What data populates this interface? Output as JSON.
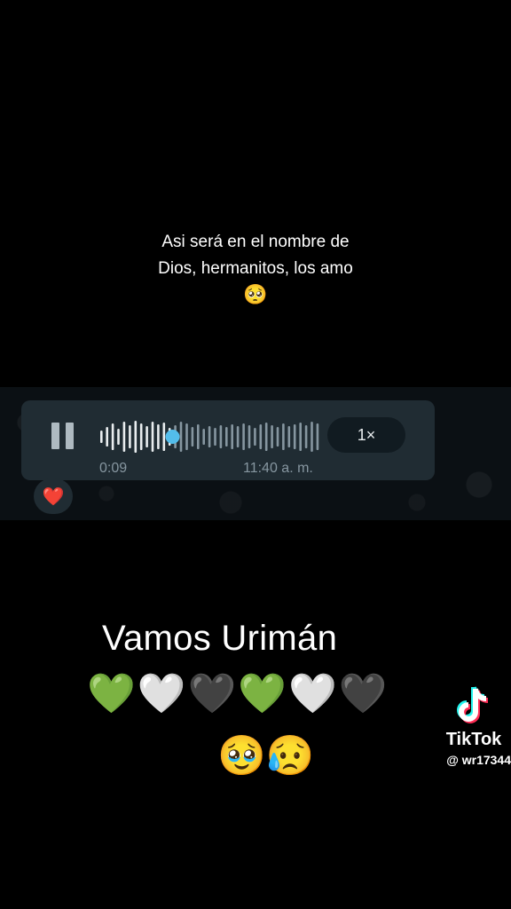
{
  "caption": {
    "line1": "Asi será en el nombre de",
    "line2": "Dios, hermanitos, los amo",
    "emoji": "🥺"
  },
  "voice_message": {
    "elapsed": "0:09",
    "time": "11:40 a. m.",
    "speed": "1×",
    "progress": 0.33,
    "reaction": "❤️",
    "accent_color": "#53bdeb"
  },
  "overlay": {
    "headline": "Vamos Urimán",
    "hearts": "💚🤍🖤💚🤍🖤",
    "faces": "🥹😥"
  },
  "watermark": {
    "brand": "TikTok",
    "handle": "@ wr17344"
  }
}
